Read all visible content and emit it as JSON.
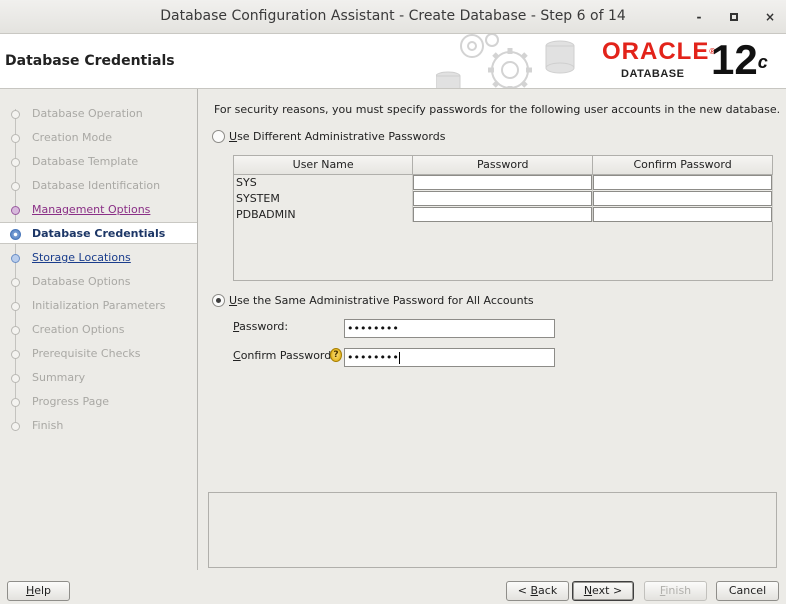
{
  "window": {
    "title": "Database Configuration Assistant - Create Database - Step 6 of 14",
    "controls": [
      "-",
      "▫",
      "×"
    ]
  },
  "header": {
    "page_title": "Database Credentials",
    "brand": "ORACLE",
    "registered": "®",
    "product": "DATABASE",
    "version": "12",
    "version_sup": "c"
  },
  "steps": [
    {
      "label": "Database Operation",
      "state": "disabled"
    },
    {
      "label": "Creation Mode",
      "state": "disabled"
    },
    {
      "label": "Database Template",
      "state": "disabled"
    },
    {
      "label": "Database Identification",
      "state": "disabled"
    },
    {
      "label": "Management Options",
      "state": "visited"
    },
    {
      "label": "Database Credentials",
      "state": "current"
    },
    {
      "label": "Storage Locations",
      "state": "link"
    },
    {
      "label": "Database Options",
      "state": "disabled"
    },
    {
      "label": "Initialization Parameters",
      "state": "disabled"
    },
    {
      "label": "Creation Options",
      "state": "disabled"
    },
    {
      "label": "Prerequisite Checks",
      "state": "disabled"
    },
    {
      "label": "Summary",
      "state": "disabled"
    },
    {
      "label": "Progress Page",
      "state": "disabled"
    },
    {
      "label": "Finish",
      "state": "disabled"
    }
  ],
  "main": {
    "intro": "For security reasons, you must specify passwords for the following user accounts in the new database.",
    "option_different": {
      "mnemonic": "U",
      "rest": "se Different Administrative Passwords",
      "checked": false
    },
    "table": {
      "columns": [
        "User Name",
        "Password",
        "Confirm Password"
      ],
      "rows": [
        {
          "user": "SYS",
          "password": "",
          "confirm": ""
        },
        {
          "user": "SYSTEM",
          "password": "",
          "confirm": ""
        },
        {
          "user": "PDBADMIN",
          "password": "",
          "confirm": ""
        }
      ]
    },
    "option_same": {
      "mnemonic": "U",
      "rest": "se the Same Administrative Password for All Accounts",
      "checked": true
    },
    "password": {
      "mnemonic": "P",
      "rest": "assword:",
      "value": "••••••••"
    },
    "confirm": {
      "mnemonic": "C",
      "rest": "onfirm Password:",
      "value": "••••••••"
    },
    "hint_icon": "?"
  },
  "footer": {
    "help": {
      "mnemonic": "H",
      "rest": "elp"
    },
    "back": {
      "prefix": "< ",
      "mnemonic": "B",
      "rest": "ack"
    },
    "next": {
      "mnemonic": "N",
      "rest": "ext >"
    },
    "finish": {
      "mnemonic": "F",
      "rest": "inish"
    },
    "cancel": "Cancel"
  },
  "colors": {
    "brand_red": "#e2231a",
    "visited_link": "#8a2f86",
    "link": "#1a3d8c",
    "current_step": "#1c3666"
  }
}
